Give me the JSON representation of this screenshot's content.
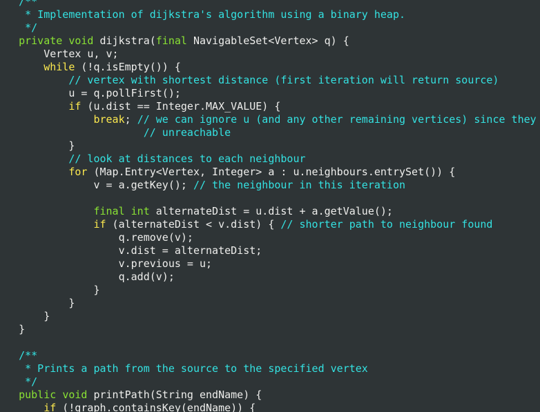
{
  "editor": {
    "colors": {
      "background": "#2e3436",
      "keyword": "#fce94f",
      "type": "#8ae234",
      "comment": "#34e2e2",
      "plain": "#eeeeec"
    },
    "lines": [
      [
        {
          "t": "   ",
          "k": "pl"
        },
        {
          "t": "/**",
          "k": "cm"
        }
      ],
      [
        {
          "t": "    * Implementation of dijkstra's algorithm using a binary heap.",
          "k": "cm"
        }
      ],
      [
        {
          "t": "    */",
          "k": "cm"
        }
      ],
      [
        {
          "t": "   ",
          "k": "pl"
        },
        {
          "t": "private",
          "k": "type"
        },
        {
          "t": " ",
          "k": "pl"
        },
        {
          "t": "void",
          "k": "type"
        },
        {
          "t": " dijkstra(",
          "k": "pl"
        },
        {
          "t": "final",
          "k": "type"
        },
        {
          "t": " NavigableSet<Vertex> q) {",
          "k": "pl"
        }
      ],
      [
        {
          "t": "       Vertex u, v;",
          "k": "pl"
        }
      ],
      [
        {
          "t": "       ",
          "k": "pl"
        },
        {
          "t": "while",
          "k": "kw"
        },
        {
          "t": " (!q.isEmpty()) {",
          "k": "pl"
        }
      ],
      [
        {
          "t": "           ",
          "k": "pl"
        },
        {
          "t": "// vertex with shortest distance (first iteration will return source)",
          "k": "cm"
        }
      ],
      [
        {
          "t": "           u = q.pollFirst();",
          "k": "pl"
        }
      ],
      [
        {
          "t": "           ",
          "k": "pl"
        },
        {
          "t": "if",
          "k": "kw"
        },
        {
          "t": " (u.dist == Integer.MAX_VALUE) {",
          "k": "pl"
        }
      ],
      [
        {
          "t": "               ",
          "k": "pl"
        },
        {
          "t": "break",
          "k": "kw"
        },
        {
          "t": "; ",
          "k": "pl"
        },
        {
          "t": "// we can ignore u (and any other remaining vertices) since they",
          "k": "cm"
        }
      ],
      [
        {
          "t": "                       ",
          "k": "pl"
        },
        {
          "t": "// unreachable",
          "k": "cm"
        }
      ],
      [
        {
          "t": "           }",
          "k": "pl"
        }
      ],
      [
        {
          "t": "           ",
          "k": "pl"
        },
        {
          "t": "// look at distances to each neighbour",
          "k": "cm"
        }
      ],
      [
        {
          "t": "           ",
          "k": "pl"
        },
        {
          "t": "for",
          "k": "kw"
        },
        {
          "t": " (Map.Entry<Vertex, Integer> a : u.neighbours.entrySet()) {",
          "k": "pl"
        }
      ],
      [
        {
          "t": "               v = a.getKey(); ",
          "k": "pl"
        },
        {
          "t": "// the neighbour in this iteration",
          "k": "cm"
        }
      ],
      [
        {
          "t": "",
          "k": "pl"
        }
      ],
      [
        {
          "t": "               ",
          "k": "pl"
        },
        {
          "t": "final",
          "k": "type"
        },
        {
          "t": " ",
          "k": "pl"
        },
        {
          "t": "int",
          "k": "type"
        },
        {
          "t": " alternateDist = u.dist + a.getValue();",
          "k": "pl"
        }
      ],
      [
        {
          "t": "               ",
          "k": "pl"
        },
        {
          "t": "if",
          "k": "kw"
        },
        {
          "t": " (alternateDist < v.dist) { ",
          "k": "pl"
        },
        {
          "t": "// shorter path to neighbour found",
          "k": "cm"
        }
      ],
      [
        {
          "t": "                   q.remove(v);",
          "k": "pl"
        }
      ],
      [
        {
          "t": "                   v.dist = alternateDist;",
          "k": "pl"
        }
      ],
      [
        {
          "t": "                   v.previous = u;",
          "k": "pl"
        }
      ],
      [
        {
          "t": "                   q.add(v);",
          "k": "pl"
        }
      ],
      [
        {
          "t": "               }",
          "k": "pl"
        }
      ],
      [
        {
          "t": "           }",
          "k": "pl"
        }
      ],
      [
        {
          "t": "       }",
          "k": "pl"
        }
      ],
      [
        {
          "t": "   }",
          "k": "pl"
        }
      ],
      [
        {
          "t": "",
          "k": "pl"
        }
      ],
      [
        {
          "t": "   ",
          "k": "pl"
        },
        {
          "t": "/**",
          "k": "cm"
        }
      ],
      [
        {
          "t": "    * Prints a path from the source to the specified vertex",
          "k": "cm"
        }
      ],
      [
        {
          "t": "    */",
          "k": "cm"
        }
      ],
      [
        {
          "t": "   ",
          "k": "pl"
        },
        {
          "t": "public",
          "k": "type"
        },
        {
          "t": " ",
          "k": "pl"
        },
        {
          "t": "void",
          "k": "type"
        },
        {
          "t": " printPath(String endName) {",
          "k": "pl"
        }
      ],
      [
        {
          "t": "       ",
          "k": "pl"
        },
        {
          "t": "if",
          "k": "kw"
        },
        {
          "t": " (!graph.containsKey(endName)) {",
          "k": "pl"
        }
      ]
    ]
  }
}
